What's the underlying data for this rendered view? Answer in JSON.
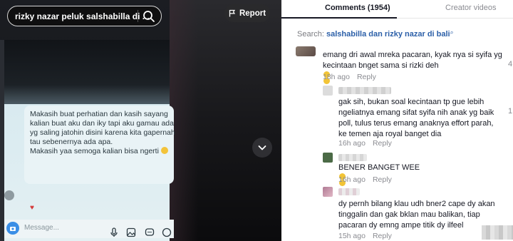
{
  "video": {
    "search_query": "rizky nazar peluk salshabilla di ...",
    "report_label": "Report",
    "chat": {
      "lines": [
        "Makasih buat perhatian dan kasih sayang",
        "kalian buat aku dan iky tapi aku gamau ada",
        "yg saling jatohin disini karena kita gapernah",
        "tau sebenernya ada apa.",
        "Makasih yaa semoga kalian bisa ngerti"
      ],
      "message_placeholder": "Message..."
    }
  },
  "panel": {
    "tabs": [
      {
        "label": "Comments (1954)",
        "active": true
      },
      {
        "label": "Creator videos",
        "active": false
      }
    ],
    "search": {
      "prefix": "Search:",
      "query": "salshabilla dan rizky nazar di bali"
    },
    "comments": [
      {
        "lines": [
          "emang dri awal mreka pacaran, kyak nya si syifa yg",
          "kecintaan bnget sama si rizki deh"
        ],
        "time": "18h ago",
        "reply_label": "Reply",
        "likes": "4"
      },
      {
        "lines": [
          "gak sih, bukan soal kecintaan tp gue lebih",
          "ngeliatnya emang sifat syifa nih anak yg baik",
          "poll, tulus terus emang anaknya effort parah,",
          "ke temen aja royal banget dia"
        ],
        "time": "16h ago",
        "reply_label": "Reply",
        "likes": "1"
      },
      {
        "lines": [
          "BENER BANGET WEE"
        ],
        "time": "16h ago",
        "reply_label": "Reply",
        "likes": ""
      },
      {
        "lines": [
          "dy pernh bilang klau udh bner2 cape dy akan",
          "tinggalin dan gak bklan mau balikan, tiap",
          "pacaran dy emng ampe titik dy ilfeel"
        ],
        "time": "15h ago",
        "reply_label": "Reply",
        "likes": ""
      }
    ]
  },
  "colors": {
    "accent_link": "#2b5fa8",
    "meta_gray": "#8a8b91",
    "panel_bg": "#ffffff",
    "video_bg": "#0b0b0d"
  }
}
